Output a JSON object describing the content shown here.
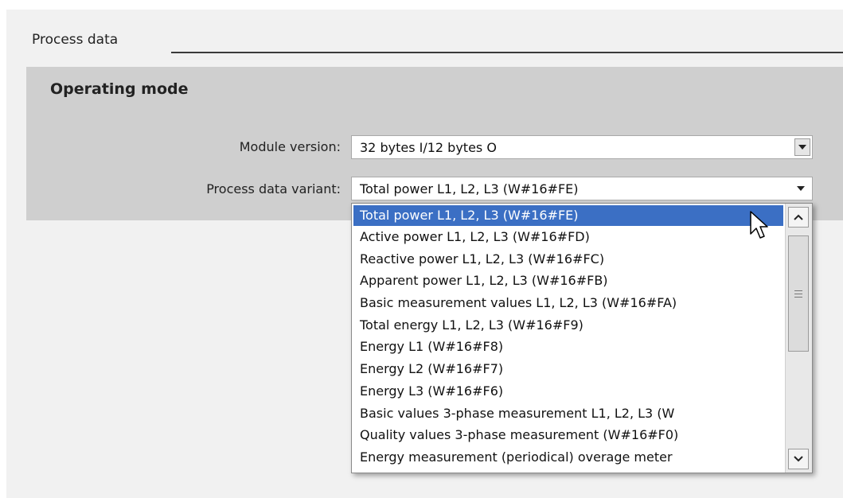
{
  "section": {
    "title": "Process data"
  },
  "group": {
    "title": "Operating mode"
  },
  "fields": {
    "module_version": {
      "label": "Module version:",
      "value": "32 bytes I/12 bytes O",
      "icon": "chevron-down-icon"
    },
    "process_data_variant": {
      "label": "Process data variant:",
      "value": "Total power L1, L2, L3 (W#16#FE)",
      "icon": "chevron-down-icon"
    }
  },
  "dropdown": {
    "selected_index": 0,
    "options": [
      "Total power L1, L2, L3 (W#16#FE)",
      "Active power L1, L2, L3 (W#16#FD)",
      "Reactive power L1, L2, L3 (W#16#FC)",
      "Apparent power L1, L2, L3 (W#16#FB)",
      "Basic measurement values L1, L2, L3 (W#16#FA)",
      "Total energy L1, L2, L3 (W#16#F9)",
      "Energy L1 (W#16#F8)",
      "Energy L2 (W#16#F7)",
      "Energy L3 (W#16#F6)",
      "Basic values 3-phase measurement L1, L2, L3 (W",
      "Quality values 3-phase measurement (W#16#F0)",
      "Energy measurement (periodical) overage meter"
    ],
    "scrollbar": {
      "up_icon": "chevron-up-icon",
      "down_icon": "chevron-down-icon",
      "grip_icon": "grip-icon"
    }
  },
  "cursor": {
    "icon": "mouse-pointer-icon"
  },
  "colors": {
    "selection": "#3b6fc4",
    "group_background": "#cfcfcf",
    "panel_background": "#f1f1f1"
  }
}
